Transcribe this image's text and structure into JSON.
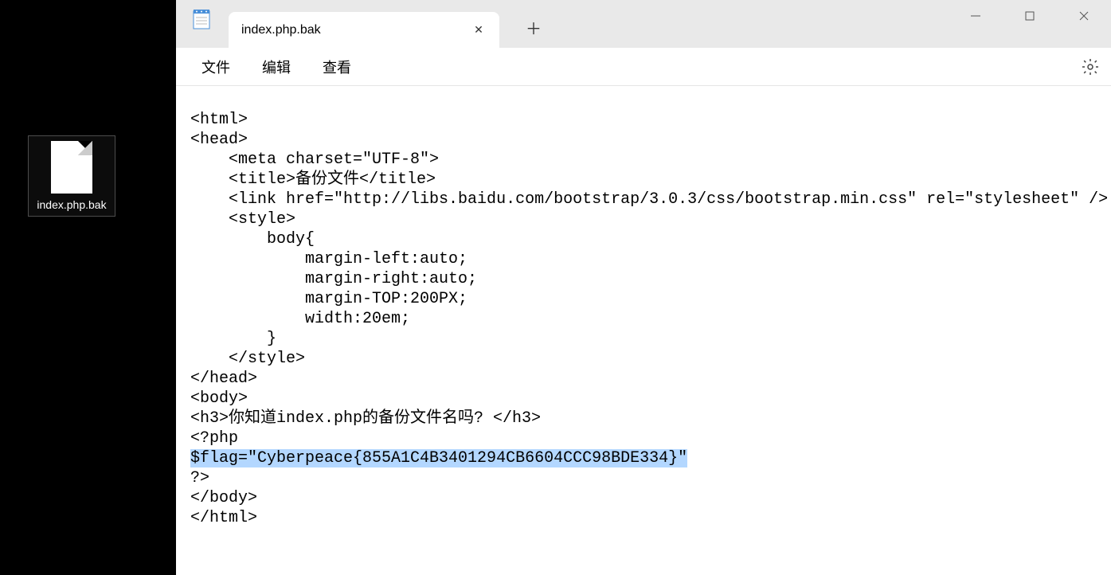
{
  "desktop": {
    "icon_label": "index.php.bak"
  },
  "window": {
    "tab_title": "index.php.bak",
    "menus": {
      "file": "文件",
      "edit": "编辑",
      "view": "查看"
    }
  },
  "editor": {
    "lines": [
      "<html>",
      "<head>",
      "    <meta charset=\"UTF-8\">",
      "    <title>备份文件</title>",
      "    <link href=\"http://libs.baidu.com/bootstrap/3.0.3/css/bootstrap.min.css\" rel=\"stylesheet\" />",
      "    <style>",
      "        body{",
      "            margin-left:auto;",
      "            margin-right:auto;",
      "            margin-TOP:200PX;",
      "            width:20em;",
      "        }",
      "    </style>",
      "</head>",
      "<body>",
      "<h3>你知道index.php的备份文件名吗? </h3>",
      "<?php"
    ],
    "highlighted_line": "$flag=\"Cyberpeace{855A1C4B3401294CB6604CCC98BDE334}\"",
    "lines_after": [
      "?>",
      "</body>",
      "</html>"
    ]
  }
}
